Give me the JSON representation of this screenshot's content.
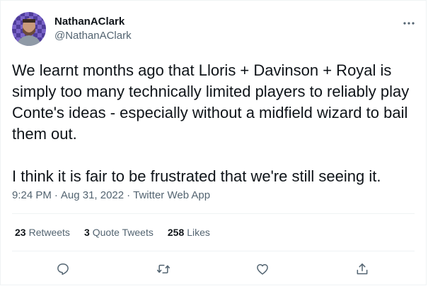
{
  "author": {
    "name": "NathanAClark",
    "handle": "@NathanAClark"
  },
  "tweet": {
    "text": "We learnt months ago that Lloris + Davinson + Royal is simply too many technically limited players to reliably play Conte's ideas - especially without a midfield wizard to bail them out.\n\nI think it is fair to be frustrated that we're still seeing it.",
    "time": "9:24 PM",
    "separator1": "·",
    "date": "Aug 31, 2022",
    "separator2": "·",
    "source": "Twitter Web App"
  },
  "stats": {
    "retweets_count": "23",
    "retweets_label": "Retweets",
    "quotes_count": "3",
    "quotes_label": "Quote Tweets",
    "likes_count": "258",
    "likes_label": "Likes"
  },
  "actions": [
    {
      "icon": "reply-icon"
    },
    {
      "icon": "retweet-icon"
    },
    {
      "icon": "like-icon"
    },
    {
      "icon": "share-icon"
    }
  ],
  "colors": {
    "text_primary": "#0f1419",
    "text_secondary": "#536471",
    "divider": "#eff3f4"
  }
}
